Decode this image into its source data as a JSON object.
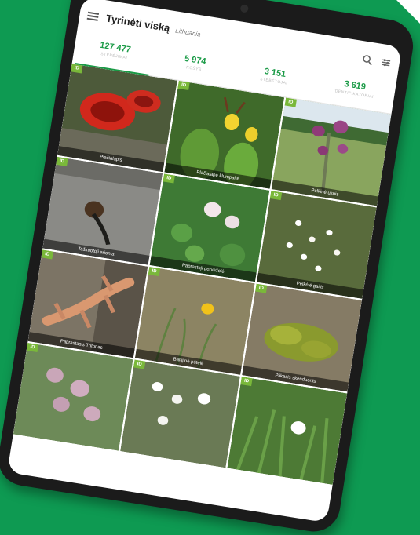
{
  "app": {
    "title": "Tyrinėti viską",
    "location": "Lithuania",
    "menu_icon": "menu-icon",
    "search_icon": "search-icon",
    "filter_icon": "filter-icon"
  },
  "tabs": [
    {
      "count": "127 477",
      "label": "STEBĖJIMAI"
    },
    {
      "count": "5 974",
      "label": "RŪŠYS"
    },
    {
      "count": "3 151",
      "label": "STEBĖTOJAI"
    },
    {
      "count": "3 619",
      "label": "IDENTIFIKATORIAI"
    }
  ],
  "badge_label": "ID",
  "observations": [
    {
      "caption": "Plačialapis",
      "scene": "cup"
    },
    {
      "caption": "Plačialapė klumpaitė",
      "scene": "orchid"
    },
    {
      "caption": "Pelkinė usnis",
      "scene": "thistle"
    },
    {
      "caption": "Taškuotoji arionta",
      "scene": "snail"
    },
    {
      "caption": "Paprastoji gervėžolė",
      "scene": "clover"
    },
    {
      "caption": "Pelkėlė gailis",
      "scene": "shrub"
    },
    {
      "caption": "Paprastasis Tritonas",
      "scene": "newt"
    },
    {
      "caption": "Baltijinė pūtelė",
      "scene": "yellow"
    },
    {
      "caption": "Plikasis skėnduonis",
      "scene": "moss"
    },
    {
      "caption": "",
      "scene": "pink"
    },
    {
      "caption": "",
      "scene": "white"
    },
    {
      "caption": "",
      "scene": "grass"
    }
  ],
  "colors": {
    "background": "#0e9a52",
    "accent": "#1a9a46",
    "badge": "#7ab83a"
  }
}
